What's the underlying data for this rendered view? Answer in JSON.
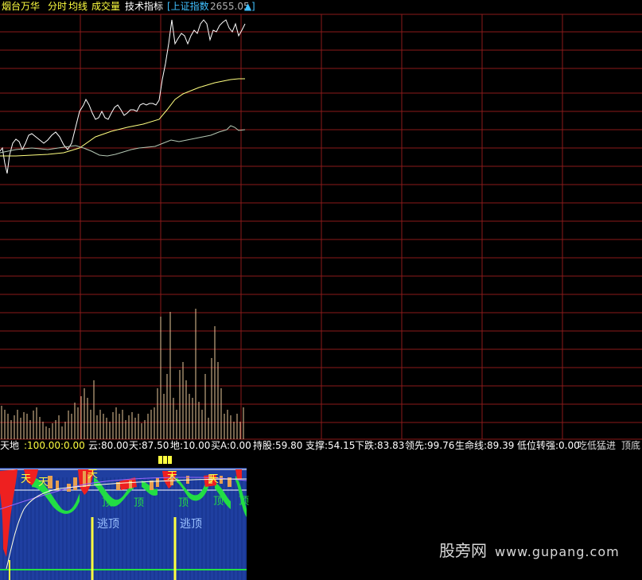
{
  "header": {
    "stock_name": "烟台万华",
    "tabs": [
      "分时",
      "均线",
      "成交量",
      "技术指标"
    ],
    "index_label": "[上证指数",
    "index_value": "2655.05",
    "index_arrow": "▲",
    "index_close": "]"
  },
  "indicator_row": {
    "items": [
      "天地",
      ":100.00",
      ":0.00",
      "云:80.00",
      "天:87.50",
      "地:10.00",
      "买A:0.00",
      "持股:59.80",
      "支撑:54.15",
      "下跌:83.83",
      "领先:99.76",
      "生命线:89.39",
      "低位转强:0.00",
      "吃低猛进",
      "顶底"
    ]
  },
  "sub_chart": {
    "labels_top": [
      "天",
      "天",
      "天",
      "天",
      "天"
    ],
    "labels_ding": [
      "顶",
      "顶",
      "顶",
      "顶",
      "顶"
    ],
    "labels_escape": [
      "逃顶",
      "逃顶"
    ]
  },
  "watermark": {
    "site_cn": "股旁网",
    "site_url": "www.gupang.com"
  },
  "colors": {
    "grid": "#8b1a1a",
    "price_line": "#ffffff",
    "avg_line": "#ffff80",
    "index_line": "#b4c8b4",
    "volume": "#e8c89a",
    "sub_bg": "#1f3fa0",
    "sub_green": "#22dd44",
    "sub_red": "#ee2020",
    "sub_orange": "#e8a050",
    "sub_yellow": "#ffff40",
    "sub_purple": "#9966ff"
  }
}
